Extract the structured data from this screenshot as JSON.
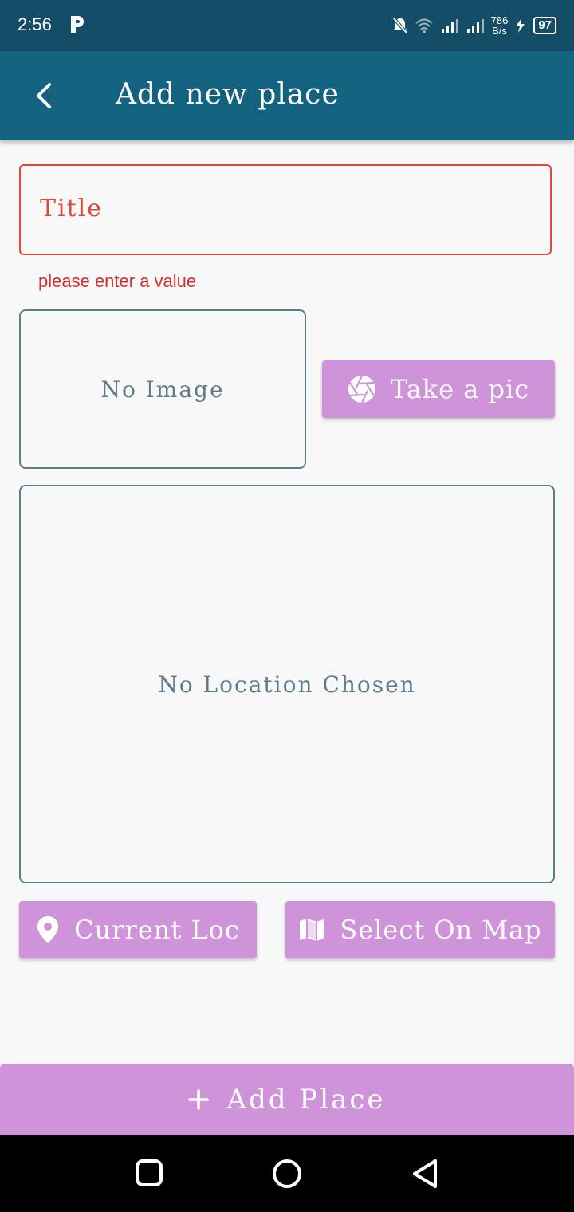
{
  "status_bar": {
    "time": "2:56",
    "net_speed_value": "786",
    "net_speed_unit": "B/s",
    "battery": "97"
  },
  "app_bar": {
    "title": "Add new place"
  },
  "form": {
    "title_label": "Title",
    "title_error": "please enter a value",
    "no_image_text": "No Image",
    "take_pic_label": "Take a pic",
    "no_location_text": "No Location Chosen",
    "current_loc_label": "Current Loc",
    "select_on_map_label": "Select On Map",
    "add_place_label": "Add Place"
  },
  "icons": {
    "back": "back-arrow-icon",
    "camera": "camera-shutter-icon",
    "location": "location-pin-icon",
    "map": "map-icon",
    "add": "plus-icon"
  },
  "colors": {
    "status_bar": "#134d66",
    "app_bar": "#136380",
    "accent_button": "#ce93d8",
    "error": "#e04a3a",
    "box_border": "#5f7c8a",
    "background": "#f8f8f8"
  }
}
